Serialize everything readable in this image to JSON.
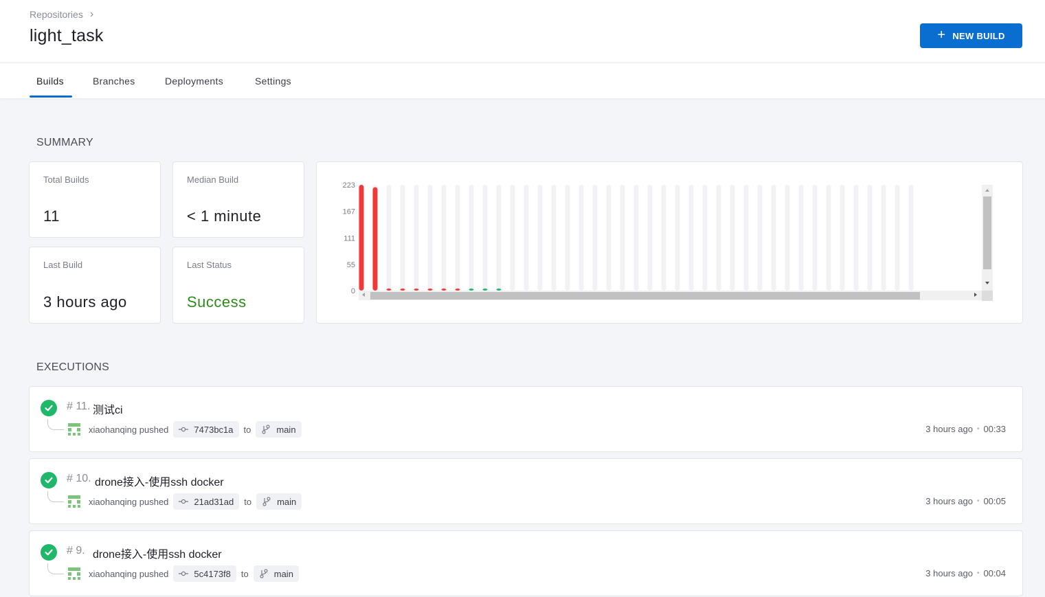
{
  "header": {
    "breadcrumb": "Repositories",
    "repo_name": "light_task",
    "new_build_label": "NEW BUILD"
  },
  "tabs": [
    {
      "label": "Builds",
      "active": true
    },
    {
      "label": "Branches",
      "active": false
    },
    {
      "label": "Deployments",
      "active": false
    },
    {
      "label": "Settings",
      "active": false
    }
  ],
  "summary": {
    "heading": "SUMMARY",
    "stats": [
      {
        "label": "Total Builds",
        "value": "11"
      },
      {
        "label": "Median Build",
        "value": "< 1 minute"
      },
      {
        "label": "Last Build",
        "value": "3 hours ago"
      },
      {
        "label": "Last Status",
        "value": "Success"
      }
    ]
  },
  "chart_data": {
    "type": "bar",
    "title": "",
    "ylabel": "",
    "xlabel": "",
    "y_ticks": [
      "223",
      "167",
      "111",
      "55",
      "0"
    ],
    "ylim": [
      0,
      223
    ],
    "values": [
      223,
      218,
      1,
      1,
      1,
      1,
      1,
      1,
      1,
      1,
      1
    ],
    "statuses": [
      "failure",
      "failure",
      "failure",
      "failure",
      "failure",
      "failure",
      "failure",
      "failure",
      "success",
      "success",
      "success"
    ],
    "empty_slots": 30,
    "colors": {
      "failure": "#f03a3a",
      "success": "#1fb86a",
      "empty": "#f1f2f6"
    },
    "grid": false,
    "scrollbars": true
  },
  "executions": {
    "heading": "EXECUTIONS",
    "items": [
      {
        "number": "# 11.",
        "title": "测试ci",
        "author": "xiaohanqing",
        "action": "pushed",
        "commit": "7473bc1a",
        "to": "to",
        "branch": "main",
        "ago": "3 hours ago",
        "duration": "00:33",
        "status": "success"
      },
      {
        "number": "# 10.",
        "title": "drone接入-使用ssh docker",
        "author": "xiaohanqing",
        "action": "pushed",
        "commit": "21ad31ad",
        "to": "to",
        "branch": "main",
        "ago": "3 hours ago",
        "duration": "00:05",
        "status": "success"
      },
      {
        "number": "# 9.",
        "title": "drone接入-使用ssh docker",
        "author": "xiaohanqing",
        "action": "pushed",
        "commit": "5c4173f8",
        "to": "to",
        "branch": "main",
        "ago": "3 hours ago",
        "duration": "00:04",
        "status": "success"
      }
    ]
  },
  "colors": {
    "accent": "#0a6ed1",
    "success": "#1fb86a",
    "failure": "#f03a3a",
    "success_text": "#2e8b1a"
  }
}
